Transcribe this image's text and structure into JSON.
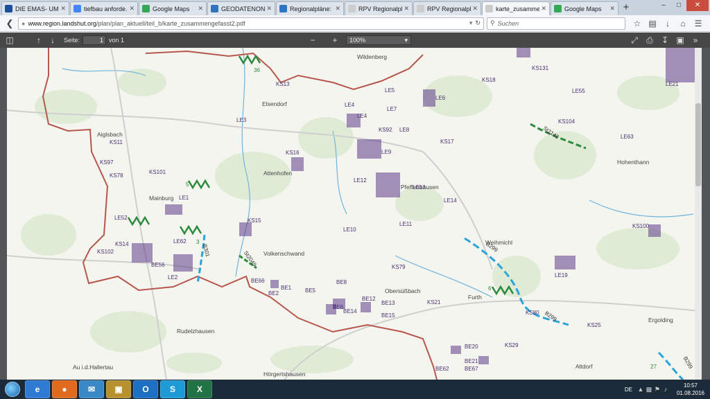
{
  "browser": {
    "tabs": [
      {
        "title": "DIE EMAS- UM...",
        "color": "#1a4f9c",
        "active": false
      },
      {
        "title": "tiefbau anforde...",
        "color": "#4285f4",
        "active": false
      },
      {
        "title": "Google Maps",
        "color": "#34a853",
        "active": false
      },
      {
        "title": "GEODATENON...",
        "color": "#2f74c0",
        "active": false
      },
      {
        "title": "Regionalpläne: ...",
        "color": "#2f74c0",
        "active": false
      },
      {
        "title": "RPV Regionalplan",
        "color": "#cccccc",
        "active": false
      },
      {
        "title": "RPV Regionalplan",
        "color": "#cccccc",
        "active": false
      },
      {
        "title": "karte_zusammenge...",
        "color": "#cccccc",
        "active": true
      },
      {
        "title": "Google Maps",
        "color": "#34a853",
        "active": false
      }
    ],
    "new_tab": "+",
    "url_domain": "www.region.landshut.org",
    "url_path": "/plan/plan_aktuell/teil_b/karte_zusammengefasst2.pdf",
    "search_placeholder": "Suchen"
  },
  "pdf_toolbar": {
    "page_label": "Seite:",
    "page_value": "1",
    "page_of": "von 1",
    "zoom": "100%"
  },
  "map": {
    "towns": [
      {
        "name": "Wildenberg"
      },
      {
        "name": "Elsendorf"
      },
      {
        "name": "Aiglsbach"
      },
      {
        "name": "Attenhofen"
      },
      {
        "name": "Hohenthann"
      },
      {
        "name": "Mainburg"
      },
      {
        "name": "Pfeffenhausen"
      },
      {
        "name": "Weihmichl"
      },
      {
        "name": "Volkenschwand"
      },
      {
        "name": "Obersüßbach"
      },
      {
        "name": "Furth"
      },
      {
        "name": "Rudelzhausen"
      },
      {
        "name": "Ergolding"
      },
      {
        "name": "Au i.d.Hallertau"
      },
      {
        "name": "Hörgertshausen"
      },
      {
        "name": "Altdorf"
      }
    ],
    "codes": [
      "KS13",
      "KS131",
      "KS18",
      "LE21",
      "LE5",
      "LE6",
      "LE55",
      "LE4",
      "LE4",
      "LE7",
      "LE8",
      "KS92",
      "KS104",
      "LE3",
      "KS11",
      "LE63",
      "KS97",
      "KS17",
      "LE9",
      "KS16",
      "KS78",
      "KS101",
      "LE12",
      "LE13",
      "LE14",
      "LE1",
      "LE52",
      "KS15",
      "LE11",
      "LE10",
      "KS100",
      "KS14",
      "LE62",
      "KS102",
      "BE56",
      "LE2",
      "KS79",
      "LE19",
      "BE66",
      "BE1",
      "BE2",
      "BE5",
      "BE8",
      "BE6",
      "BE14",
      "BE12",
      "BE13",
      "BE15",
      "KS21",
      "KS80",
      "KS25",
      "BE20",
      "KS29",
      "BE21",
      "BE62",
      "BE67"
    ],
    "corridors": [
      "36",
      "5",
      "3",
      "6",
      "27"
    ],
    "road_labels": [
      "St2143",
      "St2049",
      "B299",
      "B299",
      "B299",
      "B301"
    ]
  },
  "taskbar": {
    "language": "DE",
    "time": "10:57",
    "date": "01.08.2016",
    "apps": [
      {
        "label": "e"
      },
      {
        "label": "●"
      },
      {
        "label": "✉"
      },
      {
        "label": "▣"
      },
      {
        "label": "O"
      },
      {
        "label": "S"
      },
      {
        "label": "X"
      }
    ]
  }
}
